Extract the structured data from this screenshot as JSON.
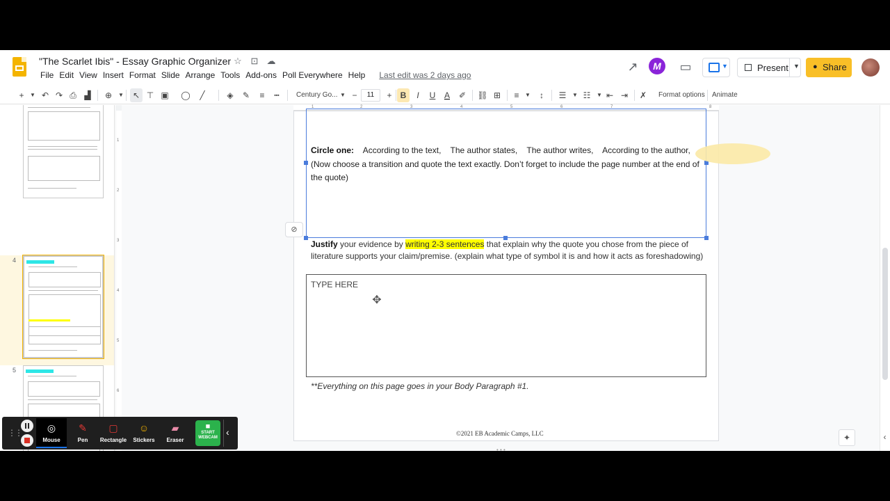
{
  "app": {
    "doc_title": "\"The Scarlet Ibis\" - Essay Graphic Organizer",
    "last_edit": "Last edit was 2 days ago"
  },
  "menu": [
    "File",
    "Edit",
    "View",
    "Insert",
    "Format",
    "Slide",
    "Arrange",
    "Tools",
    "Add-ons",
    "Poll Everywhere",
    "Help"
  ],
  "header_actions": {
    "present_label": "Present",
    "share_label": "Share"
  },
  "toolbar": {
    "font_name": "Century Go...",
    "font_size": "11",
    "bold": "B",
    "italic": "I",
    "underline": "U",
    "text_color": "A",
    "format_options": "Format options",
    "animate": "Animate"
  },
  "filmstrip": {
    "slides": [
      {
        "number": "4",
        "chip": "BODY PARAGRAPH #1"
      },
      {
        "number": "5",
        "chip": "BODY PARAGRAPH #2"
      }
    ]
  },
  "ruler": {
    "h": [
      "1",
      "2",
      "3",
      "4",
      "5",
      "6",
      "7",
      "8"
    ],
    "v": [
      "1",
      "2",
      "3",
      "4",
      "5",
      "6"
    ]
  },
  "slide": {
    "circle_label": "Circle one:",
    "circle_options": "    According to the text,    The author states,    The author writes,    According to the author,",
    "circle_instructions": "(Now choose a transition and quote the text exactly.  Don’t forget to include the page number at the end of the quote)",
    "justify_label": "Justify",
    "justify_pre": " your evidence by ",
    "justify_highlight": "writing 2-3 sentences",
    "justify_post": " that explain why the quote you chose from the piece of literature supports your claim/premise. (explain what type of symbol it is and how it acts as foreshadowing)",
    "type_here": "TYPE HERE",
    "footnote": "**Everything on this page goes in your Body Paragraph #1.",
    "copyright": "©2021 EB Academic Camps, LLC"
  },
  "cast_bar": {
    "tools": [
      "Mouse",
      "Pen",
      "Rectangle",
      "Stickers",
      "Eraser"
    ],
    "webcam_line1": "START",
    "webcam_line2": "WEBCAM"
  },
  "colors": {
    "accent_blue": "#4a7cdc",
    "share_yellow": "#f9bf27",
    "text_highlight": "#ffff00",
    "webcam_green": "#2bb24c"
  }
}
